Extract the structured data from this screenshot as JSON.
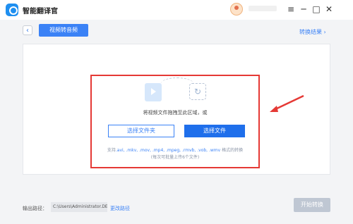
{
  "app": {
    "title": "智能翻译官"
  },
  "window_controls": {
    "menu_icon": "≡",
    "minimize_icon": "─",
    "maximize_icon": "□",
    "close_icon": "✕"
  },
  "toolbar": {
    "back_icon": "‹",
    "tab_label": "视频转音频",
    "results_link": "转换结果 ›"
  },
  "dropzone": {
    "convert_icon": "↻",
    "hint": "将视频文件拖拽至此区域，或",
    "select_folder_label": "选择文件夹",
    "select_file_label": "选择文件",
    "formats_prefix": "支持",
    "formats": ".avi, .mkv, .mov, .mp4, .mpeg, .rmvb, .vob, .wmv",
    "formats_suffix": " 格式的转换",
    "limit": "(每次可批量上传6个文件)"
  },
  "footer": {
    "output_label": "输出路径：",
    "output_path": "C:\\Users\\Administrator.DE...",
    "change_path_label": "更改路径",
    "start_label": "开始转换"
  },
  "colors": {
    "accent": "#3b82f6",
    "primary_button": "#1f6feb",
    "highlight_border": "#e53935",
    "disabled_button": "#bfc7d3"
  }
}
